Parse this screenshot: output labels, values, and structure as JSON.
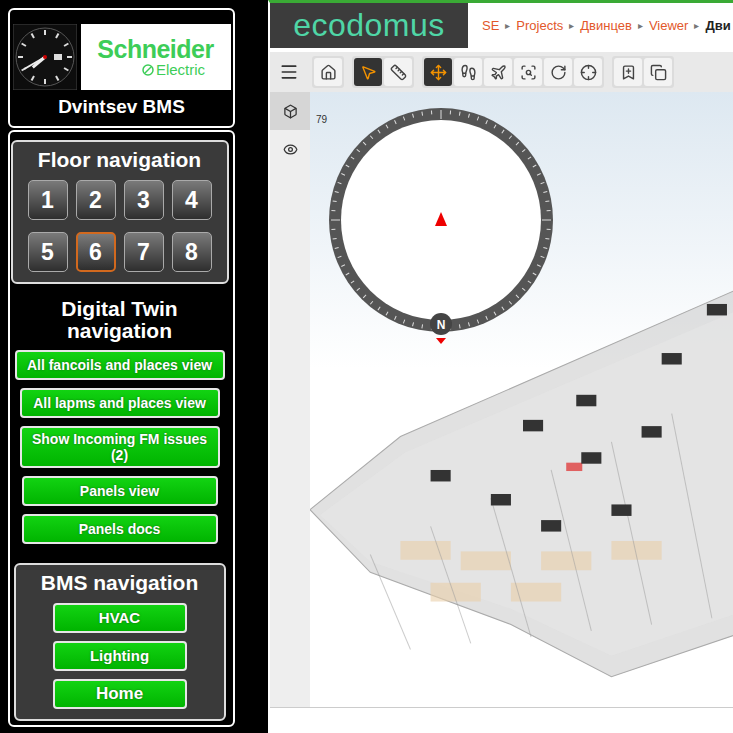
{
  "sidebar": {
    "clock": {
      "hour": 7,
      "minute": 40
    },
    "logo": {
      "brand": "Schneider",
      "sub": "Electric"
    },
    "title": "Dvintsev BMS",
    "floor_navigation": {
      "title": "Floor navigation",
      "floors": [
        {
          "label": "1",
          "selected": false
        },
        {
          "label": "2",
          "selected": false
        },
        {
          "label": "3",
          "selected": false
        },
        {
          "label": "4",
          "selected": false
        },
        {
          "label": "5",
          "selected": false
        },
        {
          "label": "6",
          "selected": true
        },
        {
          "label": "7",
          "selected": false
        },
        {
          "label": "8",
          "selected": false
        }
      ]
    },
    "digital_twin": {
      "title": "Digital Twin navigation",
      "buttons": [
        "All fancoils and places view",
        "All lapms and places view",
        "Show Incoming FM issues (2)",
        "Panels view",
        "Panels docs"
      ]
    },
    "bms_navigation": {
      "title": "BMS navigation",
      "buttons": [
        "HVAC",
        "Lighting",
        "Home"
      ]
    }
  },
  "header": {
    "logo": "ecodomus",
    "breadcrumb": [
      "SE",
      "Projects",
      "Двинцев",
      "Viewer",
      "Дви"
    ],
    "separator": "▸"
  },
  "toolbar": {
    "groups": [
      [
        {
          "selected": false
        }
      ],
      [
        {
          "selected": true
        },
        {
          "selected": false
        }
      ],
      [
        {
          "selected": true
        },
        {
          "selected": false
        },
        {
          "selected": false
        },
        {
          "selected": false
        },
        {
          "selected": false
        },
        {
          "selected": false
        }
      ],
      [
        {
          "selected": false
        },
        {
          "selected": false
        }
      ]
    ]
  },
  "side_tabs": [
    {
      "selected": true
    },
    {
      "selected": false
    }
  ],
  "viewer": {
    "counter": "79",
    "compass": {
      "label": "N"
    }
  }
}
